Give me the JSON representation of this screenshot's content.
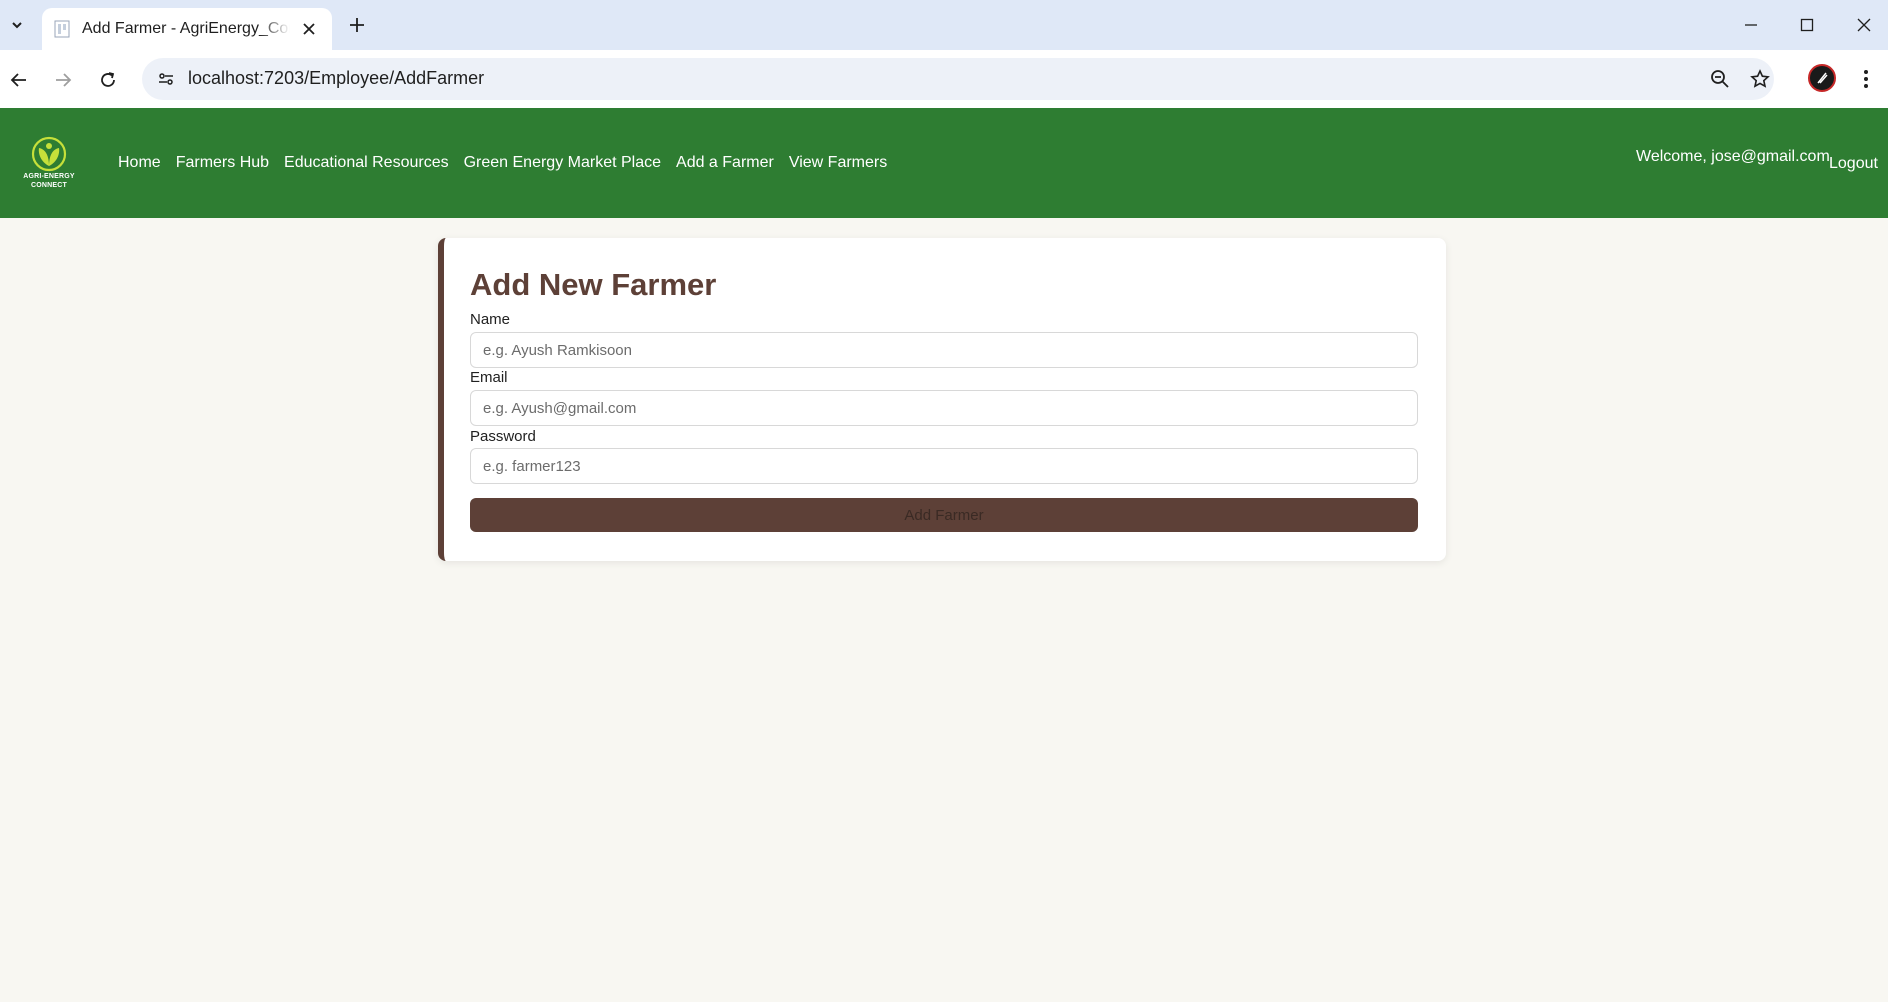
{
  "browser": {
    "tab_title": "Add Farmer - AgriEnergy_Connect",
    "url": "localhost:7203/Employee/AddFarmer"
  },
  "site": {
    "logo_text_line1": "AGRI-ENERGY",
    "logo_text_line2": "CONNECT",
    "brand_color": "#2e7d32",
    "nav": [
      {
        "label": "Home"
      },
      {
        "label": "Farmers Hub"
      },
      {
        "label": "Educational Resources"
      },
      {
        "label": "Green Energy Market Place"
      },
      {
        "label": "Add a Farmer"
      },
      {
        "label": "View Farmers"
      }
    ],
    "welcome": "Welcome, jose@gmail.com",
    "logout": "Logout"
  },
  "form": {
    "title": "Add New Farmer",
    "accent_color": "#5d4037",
    "name_label": "Name",
    "name_placeholder": "e.g. Ayush Ramkisoon",
    "email_label": "Email",
    "email_placeholder": "e.g. Ayush@gmail.com",
    "password_label": "Password",
    "password_placeholder": "e.g. farmer123",
    "submit_label": "Add Farmer"
  }
}
